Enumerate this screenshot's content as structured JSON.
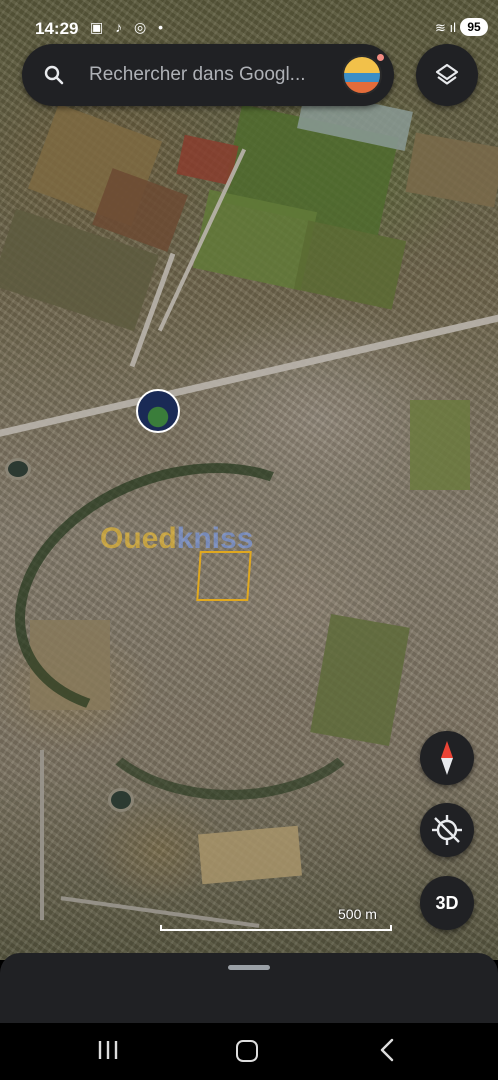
{
  "status_bar": {
    "time": "14:29",
    "app_icons": "▣ ♪ ◎ •",
    "signal": "≋ ıl",
    "battery": "95"
  },
  "search": {
    "placeholder": "Rechercher dans Googl..."
  },
  "map": {
    "watermark": "Ouedkniss",
    "watermark_part_a": "Oued",
    "watermark_part_b": "kniss",
    "scale_label": "500 m"
  },
  "controls": {
    "three_d_label": "3D"
  },
  "icons": {
    "search": "search-icon",
    "layers": "layers-icon",
    "compass": "compass-icon",
    "gps": "location-off-icon",
    "recents": "recents-icon",
    "home": "home-icon",
    "back": "back-icon"
  }
}
